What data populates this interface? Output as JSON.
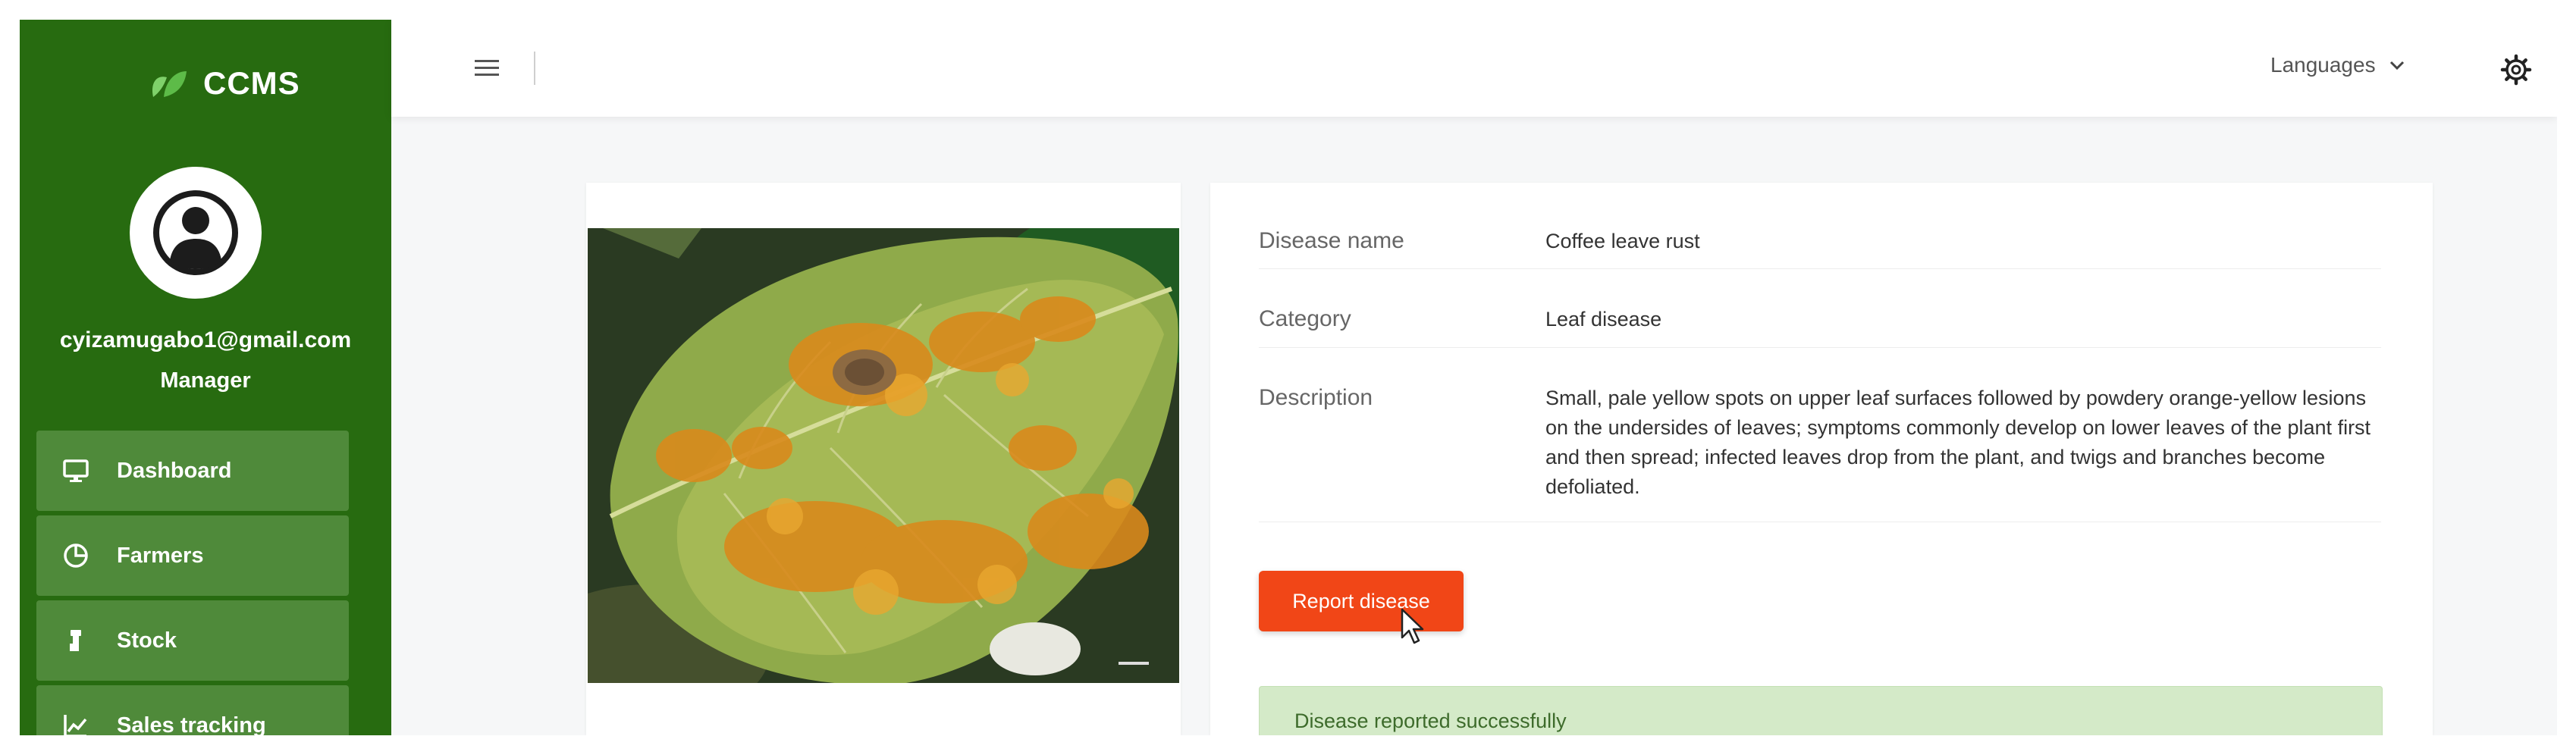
{
  "app": {
    "brand": "CCMS"
  },
  "user": {
    "email": "cyizamugabo1@gmail.com",
    "role": "Manager"
  },
  "sidebar": {
    "items": [
      {
        "label": "Dashboard",
        "icon": "monitor-icon"
      },
      {
        "label": "Farmers",
        "icon": "pie-chart-icon"
      },
      {
        "label": "Stock",
        "icon": "stock-icon"
      },
      {
        "label": "Sales tracking",
        "icon": "line-chart-icon"
      }
    ]
  },
  "topbar": {
    "languages_label": "Languages",
    "settings_icon": "gear-icon",
    "menu_icon": "hamburger-icon"
  },
  "disease": {
    "name_label": "Disease name",
    "name": "Coffee leave rust",
    "category_label": "Category",
    "category": "Leaf disease",
    "description_label": "Description",
    "description": "Small, pale yellow spots on upper leaf surfaces followed by powdery orange-yellow lesions on the undersides of leaves; symptoms commonly develop on lower leaves of the plant first and then spread; infected leaves drop from the plant, and twigs and branches become defoliated."
  },
  "actions": {
    "report_label": "Report disease"
  },
  "alert": {
    "success_text": "Disease reported successfully"
  },
  "colors": {
    "sidebar": "#276b10",
    "nav_item": "#4f8a3a",
    "button": "#f14617",
    "alert_bg": "#d4eac8"
  }
}
